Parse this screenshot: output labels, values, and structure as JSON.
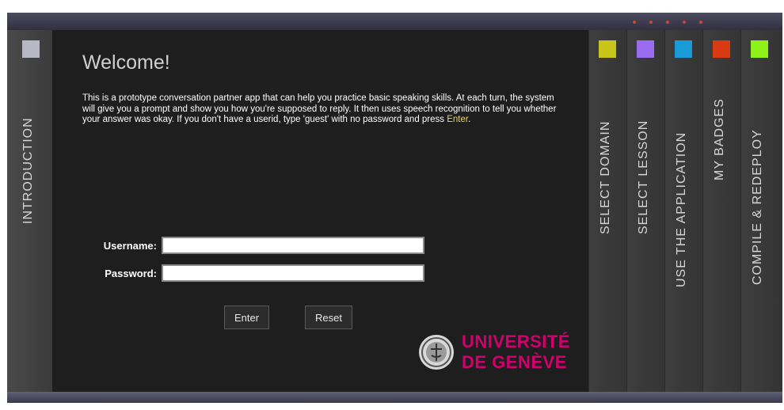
{
  "left_tab": {
    "label": "INTRODUCTION",
    "color": "#b8b8c4"
  },
  "main": {
    "title": "Welcome!",
    "intro_text": "This is a prototype conversation partner app that can help you practice basic speaking skills. At each turn, the system will give you a prompt and show you how you're supposed to reply. It then uses speech recognition to tell you whether your answer was okay. If you don't have a userid, type 'guest' with no password and press ",
    "intro_highlight": "Enter",
    "intro_end": "."
  },
  "form": {
    "username_label": "Username:",
    "username_value": "",
    "password_label": "Password:",
    "password_value": "",
    "enter_label": "Enter",
    "reset_label": "Reset"
  },
  "logo": {
    "line1": "UNIVERSITÉ",
    "line2": "DE GENÈVE",
    "color": "#d1006e"
  },
  "right_tabs": [
    {
      "label": "SELECT DOMAIN",
      "color": "#c8c41a"
    },
    {
      "label": "SELECT LESSON",
      "color": "#9a6cf0"
    },
    {
      "label": "USE THE APPLICATION",
      "color": "#1a9ad6"
    },
    {
      "label": "MY BADGES",
      "color": "#d83a12"
    },
    {
      "label": "COMPILE & REDEPLOY",
      "color": "#8ef21a"
    }
  ]
}
